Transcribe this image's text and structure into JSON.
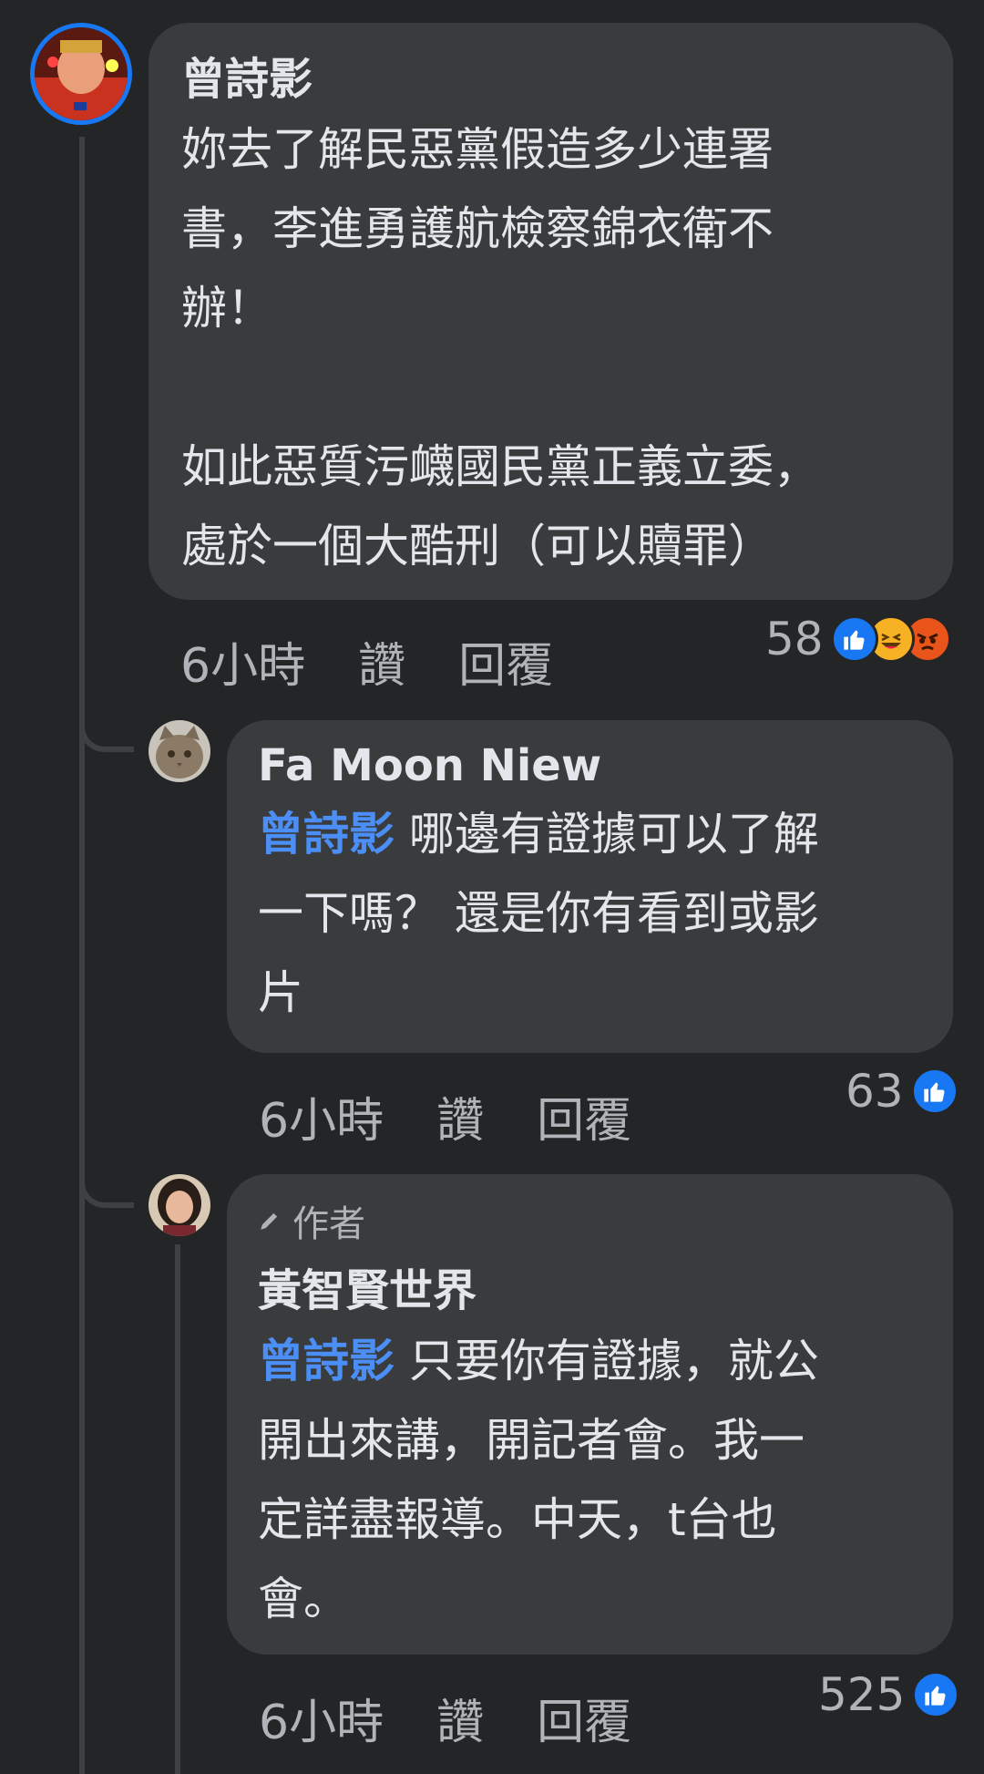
{
  "comments": [
    {
      "author": "曾詩影",
      "text": "妳去了解民惡黨假造多少連署\n書，李進勇護航檢察錦衣衛不\n辦！\n\n如此惡質污衊國民黨正義立委，\n處於一個大酷刑（可以贖罪）",
      "time": "6小時",
      "like_label": "讚",
      "reply_label": "回覆",
      "reaction_count": "58",
      "reactions": [
        "like-icon",
        "haha-icon",
        "angry-icon"
      ]
    },
    {
      "author": "Fa Moon Niew",
      "mention": "曾詩影",
      "text": " 哪邊有證據可以了解\n一下嗎？ 還是你有看到或影\n片",
      "time": "6小時",
      "like_label": "讚",
      "reply_label": "回覆",
      "reaction_count": "63",
      "reactions": [
        "like-icon"
      ]
    },
    {
      "badge": "作者",
      "author": "黃智賢世界",
      "mention": "曾詩影",
      "text": " 只要你有證據，就公\n開出來講，開記者會。我一\n定詳盡報導。中天，t台也\n會。",
      "time": "6小時",
      "like_label": "讚",
      "reply_label": "回覆",
      "reaction_count": "525",
      "reactions": [
        "like-icon"
      ]
    }
  ],
  "colors": {
    "background": "#242526",
    "bubble": "#3a3b3c",
    "mention": "#4b8ef5",
    "like": "#1877f2"
  }
}
